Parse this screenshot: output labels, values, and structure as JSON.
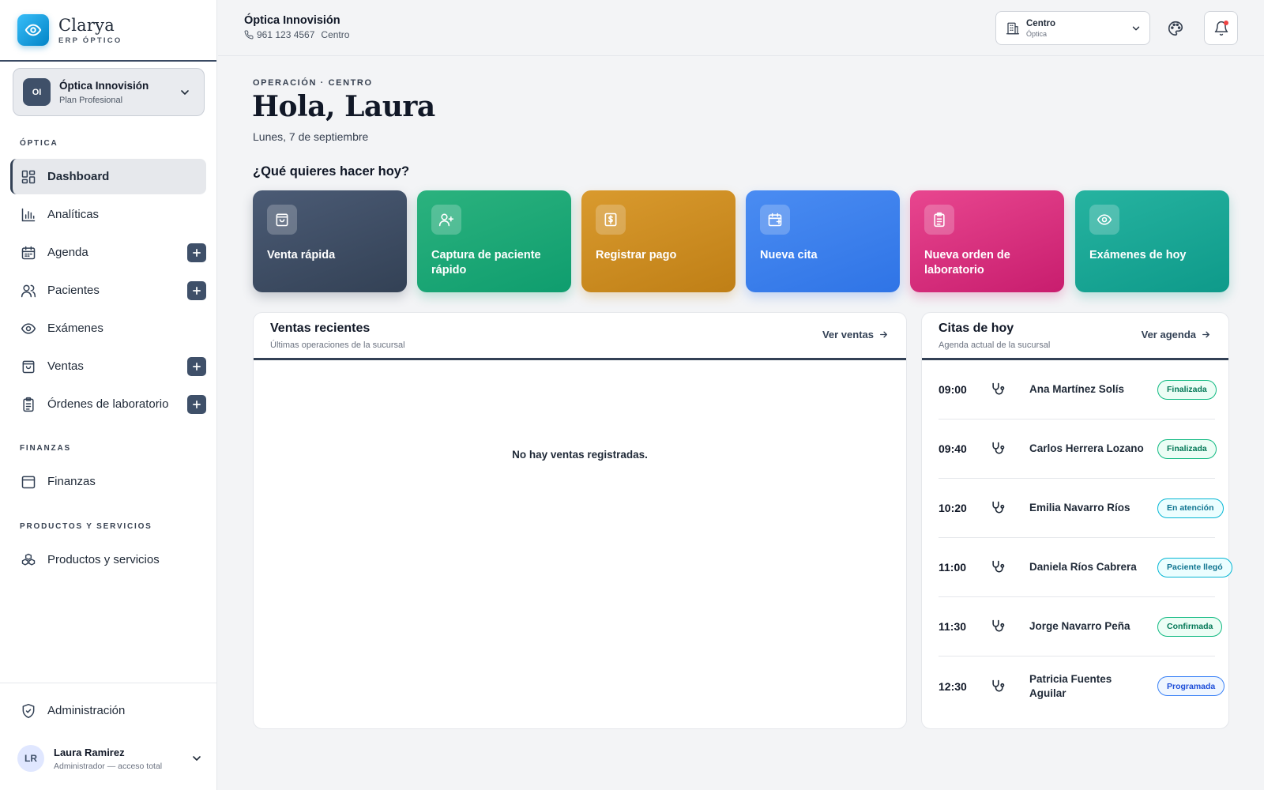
{
  "brand": {
    "name": "Clarya",
    "subtitle": "ERP ÓPTICO"
  },
  "org": {
    "initials": "OI",
    "name": "Óptica Innovisión",
    "plan": "Plan Profesional"
  },
  "sidebar": {
    "sections": [
      {
        "label": "ÓPTICA"
      },
      {
        "label": "FINANZAS"
      },
      {
        "label": "PRODUCTOS Y SERVICIOS"
      }
    ],
    "items": [
      {
        "label": "Dashboard",
        "icon": "dashboard-icon",
        "active": true
      },
      {
        "label": "Analíticas",
        "icon": "bar-chart-icon"
      },
      {
        "label": "Agenda",
        "icon": "calendar-icon",
        "add": true
      },
      {
        "label": "Pacientes",
        "icon": "users-icon",
        "add": true
      },
      {
        "label": "Exámenes",
        "icon": "eye-icon"
      },
      {
        "label": "Ventas",
        "icon": "shopping-bag-icon",
        "add": true
      },
      {
        "label": "Órdenes de laboratorio",
        "icon": "clipboard-icon",
        "add": true
      },
      {
        "label": "Finanzas",
        "icon": "wallet-icon"
      },
      {
        "label": "Productos y servicios",
        "icon": "boxes-icon"
      }
    ],
    "admin": {
      "label": "Administración",
      "icon": "shield-icon"
    },
    "user": {
      "initials": "LR",
      "name": "Laura Ramirez",
      "role": "Administrador — acceso total"
    }
  },
  "topbar": {
    "title": "Óptica Innovisión",
    "phone": "961 123 4567",
    "branch_label": "Centro",
    "branch_select": {
      "name": "Centro",
      "type": "Óptica"
    },
    "notification_dot_color": "#ef4444"
  },
  "main": {
    "overline": "OPERACIÓN · CENTRO",
    "greeting": "Hola, Laura",
    "date": "Lunes, 7 de septiembre",
    "question": "¿Qué quieres hacer hoy?",
    "actions": [
      {
        "label": "Venta rápida",
        "icon": "shopping-bag-icon",
        "color": "#3f5069"
      },
      {
        "label": "Captura de paciente rápido",
        "icon": "user-plus-icon",
        "color": "#1fa774"
      },
      {
        "label": "Registrar pago",
        "icon": "receipt-dollar-icon",
        "color": "#cc8c22"
      },
      {
        "label": "Nueva cita",
        "icon": "calendar-plus-icon",
        "color": "#3b82ec"
      },
      {
        "label": "Nueva orden de laboratorio",
        "icon": "clipboard-icon",
        "color": "#d8307e"
      },
      {
        "label": "Exámenes de hoy",
        "icon": "eye-icon",
        "color": "#1aa695"
      }
    ],
    "sales": {
      "title": "Ventas recientes",
      "subtitle": "Últimas operaciones de la sucursal",
      "link": "Ver ventas",
      "empty": "No hay ventas registradas."
    },
    "appointments": {
      "title": "Citas de hoy",
      "subtitle": "Agenda actual de la sucursal",
      "link": "Ver agenda",
      "rows": [
        {
          "time": "09:00",
          "name": "Ana Martínez Solís",
          "status": "Finalizada",
          "tone": "green"
        },
        {
          "time": "09:40",
          "name": "Carlos Herrera Lozano",
          "status": "Finalizada",
          "tone": "green"
        },
        {
          "time": "10:20",
          "name": "Emilia Navarro Ríos",
          "status": "En atención",
          "tone": "cyan"
        },
        {
          "time": "11:00",
          "name": "Daniela Ríos Cabrera",
          "status": "Paciente llegó",
          "tone": "cyan"
        },
        {
          "time": "11:30",
          "name": "Jorge Navarro Peña",
          "status": "Confirmada",
          "tone": "green"
        },
        {
          "time": "12:30",
          "name": "Patricia Fuentes Aguilar",
          "status": "Programada",
          "tone": "blue"
        }
      ]
    }
  }
}
